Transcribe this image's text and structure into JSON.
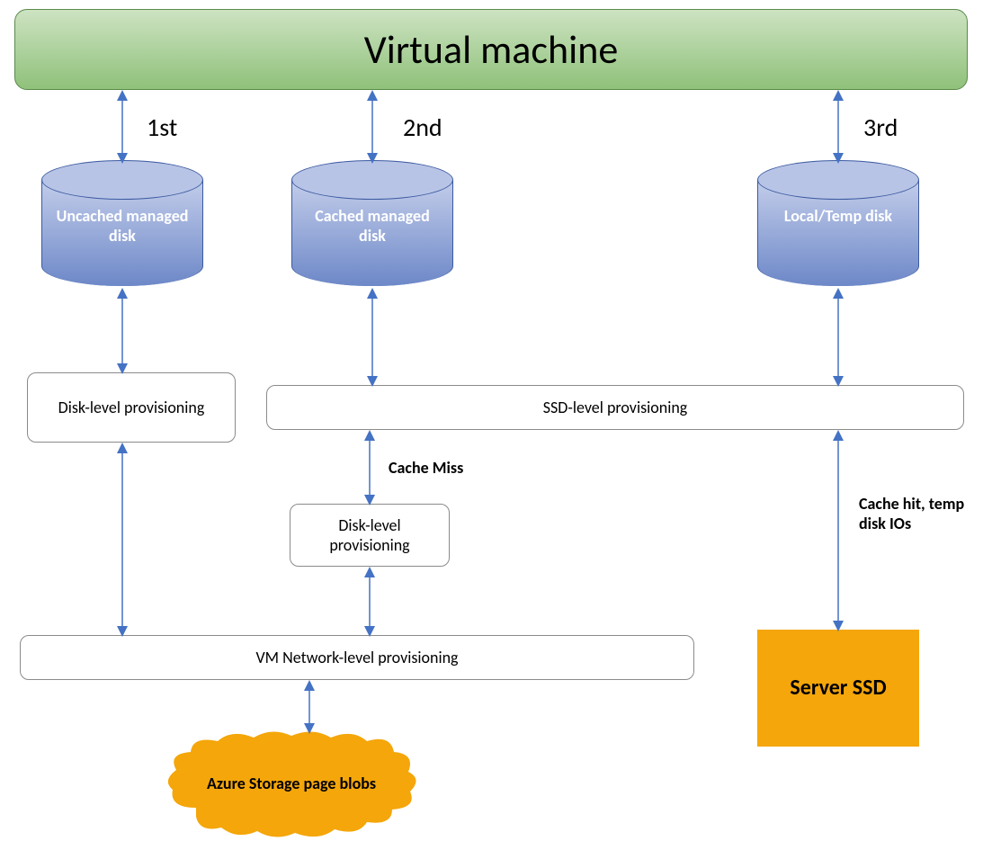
{
  "header": {
    "title": "Virtual machine"
  },
  "ordinals": {
    "first": "1st",
    "second": "2nd",
    "third": "3rd"
  },
  "cylinders": {
    "uncached": "Uncached managed disk",
    "cached": "Cached managed disk",
    "local": "Local/Temp disk"
  },
  "boxes": {
    "disk_level_left": "Disk-level provisioning",
    "ssd_level": "SSD-level provisioning",
    "disk_level_mid": "Disk-level provisioning",
    "vm_network": "VM Network-level provisioning",
    "server_ssd": "Server SSD"
  },
  "annotations": {
    "cache_miss": "Cache Miss",
    "cache_hit": "Cache hit, temp disk IOs"
  },
  "cloud": {
    "label": "Azure Storage page blobs"
  },
  "colors": {
    "arrow": "#4472c4",
    "orange": "#f4a60a"
  }
}
